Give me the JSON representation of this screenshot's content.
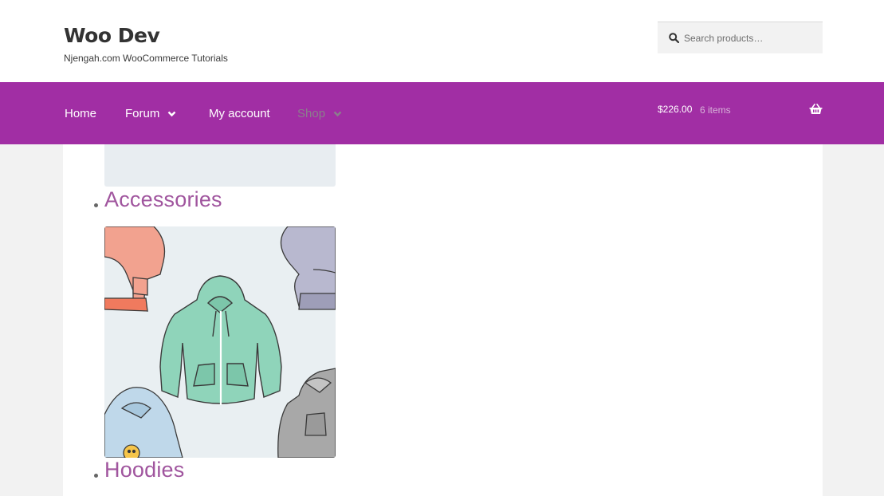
{
  "site": {
    "title": "Woo Dev",
    "tagline": "Njengah.com WooCommerce Tutorials"
  },
  "search": {
    "placeholder": "Search products…",
    "value": ""
  },
  "nav": {
    "items": [
      {
        "label": "Home",
        "has_dropdown": false,
        "active": false
      },
      {
        "label": "Forum",
        "has_dropdown": true,
        "active": false
      },
      {
        "label": "My account",
        "has_dropdown": false,
        "active": false
      },
      {
        "label": "Shop",
        "has_dropdown": true,
        "active": true
      }
    ]
  },
  "cart": {
    "amount": "$226.00",
    "count": "6 items",
    "icon": "basket-icon"
  },
  "categories": [
    {
      "name": "Accessories",
      "image": "hoodies-illustration"
    },
    {
      "name": "Hoodies"
    }
  ],
  "colors": {
    "nav_bg": "#a12ea4",
    "link": "#a0559e",
    "header_bg": "#ffffff",
    "page_bg": "#f2f2f2"
  }
}
